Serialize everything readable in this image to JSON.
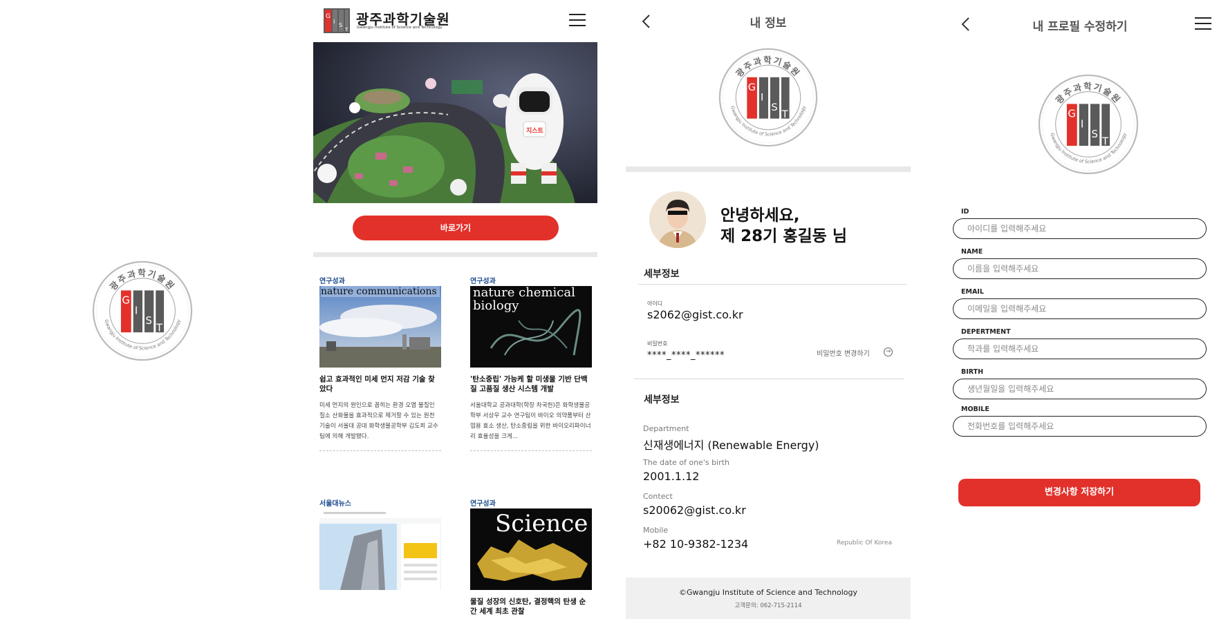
{
  "seal": {
    "kr_text": "광주과학기술원",
    "en_text": "Gwangju Institute of Science and Technology",
    "letters": [
      "G",
      "I",
      "S",
      "T"
    ]
  },
  "colors": {
    "brand_red": "#e2312b",
    "seal_gray": "#5a5a5a",
    "tag_blue": "#1b4a8f"
  },
  "home": {
    "logo_kr": "광주과학기술원",
    "logo_en": "Gwangju Institute of Science and Technology",
    "mascot_badge": "지스트",
    "cta_label": "바로가기",
    "news": [
      {
        "tag": "연구성과",
        "thumb_text": "nature communications",
        "title": "쉽고 효과적인 미세 먼지 저감 기술 찾았다",
        "desc": "미세 먼지의 원인으로 꼽히는 환경 오염 물질인 질소 산화물을 효과적으로 제거할 수 있는 원천 기술이 서울대 공대 화학생물공학부 김도희 교수팀에 의해 개발됐다."
      },
      {
        "tag": "연구성과",
        "thumb_text": "nature chemical biology",
        "title": "'탄소중립' 가능케 할 미생물 기반 단백질 고품질 생산 시스템 개발",
        "desc": "서울대학교 공과대학(학장 차국헌)은 화학생물공학부 서상우 교수 연구팀이 바이오 의약품부터 산업용 효소 생산, 탄소중립을 위한 바이오리파이너리 효율성을 크게..."
      },
      {
        "tag": "서울대뉴스",
        "thumb_text": "",
        "title": "",
        "desc": ""
      },
      {
        "tag": "연구성과",
        "thumb_text": "Science",
        "title": "물질 성장의 신호탄, 결정핵의 탄생 순간 세계 최초 관찰",
        "desc": ""
      }
    ]
  },
  "myinfo": {
    "title": "내 정보",
    "greeting_line1": "안녕하세요,",
    "greeting_line2": "제 28기 홍길동 님",
    "section1": "세부정보",
    "id_label": "아이디",
    "id_value": "s2062@gist.co.kr",
    "pw_label": "비밀번호",
    "pw_value": "****_****_******",
    "pw_change": "비밀번호 변경하기",
    "section2": "세부정보",
    "details": [
      {
        "label": "Department",
        "value": "신재생에너지 (Renewable Energy)"
      },
      {
        "label": "The date of one's birth",
        "value": "2001.1.12"
      },
      {
        "label": "Contect",
        "value": "s20062@gist.co.kr"
      },
      {
        "label": "Mobile",
        "value": "+82 10-9382-1234"
      }
    ],
    "region": "Republic Of Korea",
    "footer_copyright": "©Gwangju Institute of Science and Technology",
    "footer_contact": "고객문의: 062-715-2114"
  },
  "edit": {
    "title": "내 프로필 수정하기",
    "fields": [
      {
        "label": "ID",
        "placeholder": "아이디를 입력해주세요"
      },
      {
        "label": "NAME",
        "placeholder": "이름을 입력해주세요"
      },
      {
        "label": "EMAIL",
        "placeholder": "이메일을 입력해주세요"
      },
      {
        "label": "DEPERTMENT",
        "placeholder": "학과를 입력해주세요"
      },
      {
        "label": "BIRTH",
        "placeholder": "생년월일을 입력해주세요"
      },
      {
        "label": "MOBILE",
        "placeholder": "전화번호를 입력해주세요"
      }
    ],
    "save_label": "변경사항 저장하기"
  }
}
